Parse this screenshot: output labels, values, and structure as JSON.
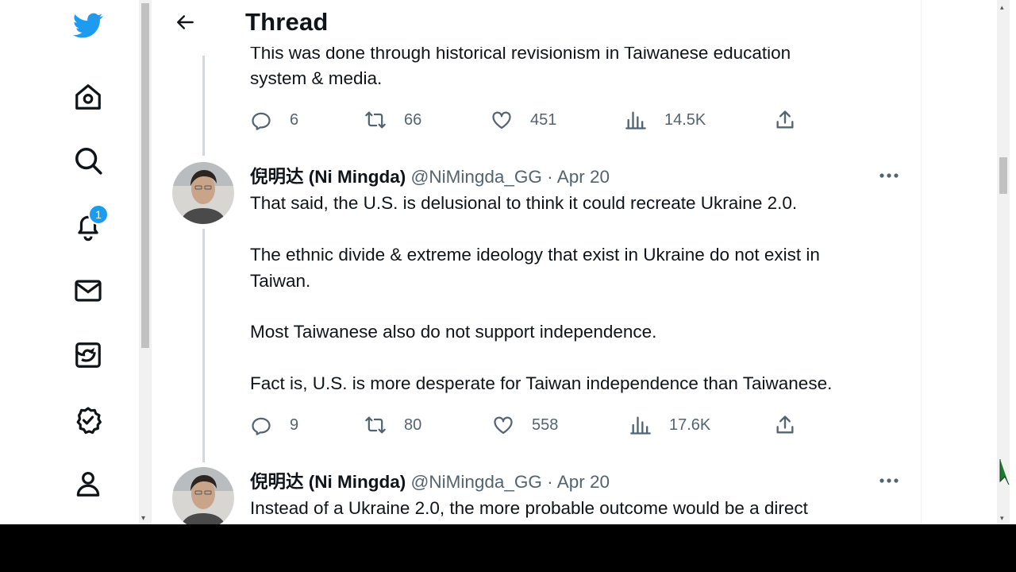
{
  "header": {
    "title": "Thread"
  },
  "nav": {
    "notifications_badge": "1"
  },
  "top_tweet": {
    "text_partial": "This was done through historical revisionism in Taiwanese education",
    "text_line2": "system & media.",
    "actions": {
      "replies": "6",
      "retweets": "66",
      "likes": "451",
      "views": "14.5K"
    }
  },
  "tweet2": {
    "name": "倪明达 (Ni Mingda)",
    "handle": "@NiMingda_GG",
    "dot": "·",
    "date": "Apr 20",
    "p1": "That said, the U.S. is delusional to think it could recreate Ukraine 2.0.",
    "p2": "The ethnic divide & extreme ideology that exist in Ukraine do not exist in\nTaiwan.",
    "p3": "Most Taiwanese also do not support independence.",
    "p4": "Fact is, U.S. is more desperate for Taiwan independence than Taiwanese.",
    "actions": {
      "replies": "9",
      "retweets": "80",
      "likes": "558",
      "views": "17.6K"
    }
  },
  "tweet3": {
    "name": "倪明达 (Ni Mingda)",
    "handle": "@NiMingda_GG",
    "dot": "·",
    "date": "Apr 20",
    "text": "Instead of a Ukraine 2.0, the more probable outcome would be a direct"
  },
  "colors": {
    "brand": "#1d9bf0",
    "secondary_text": "#536471",
    "thread_line": "#cfd9de"
  }
}
